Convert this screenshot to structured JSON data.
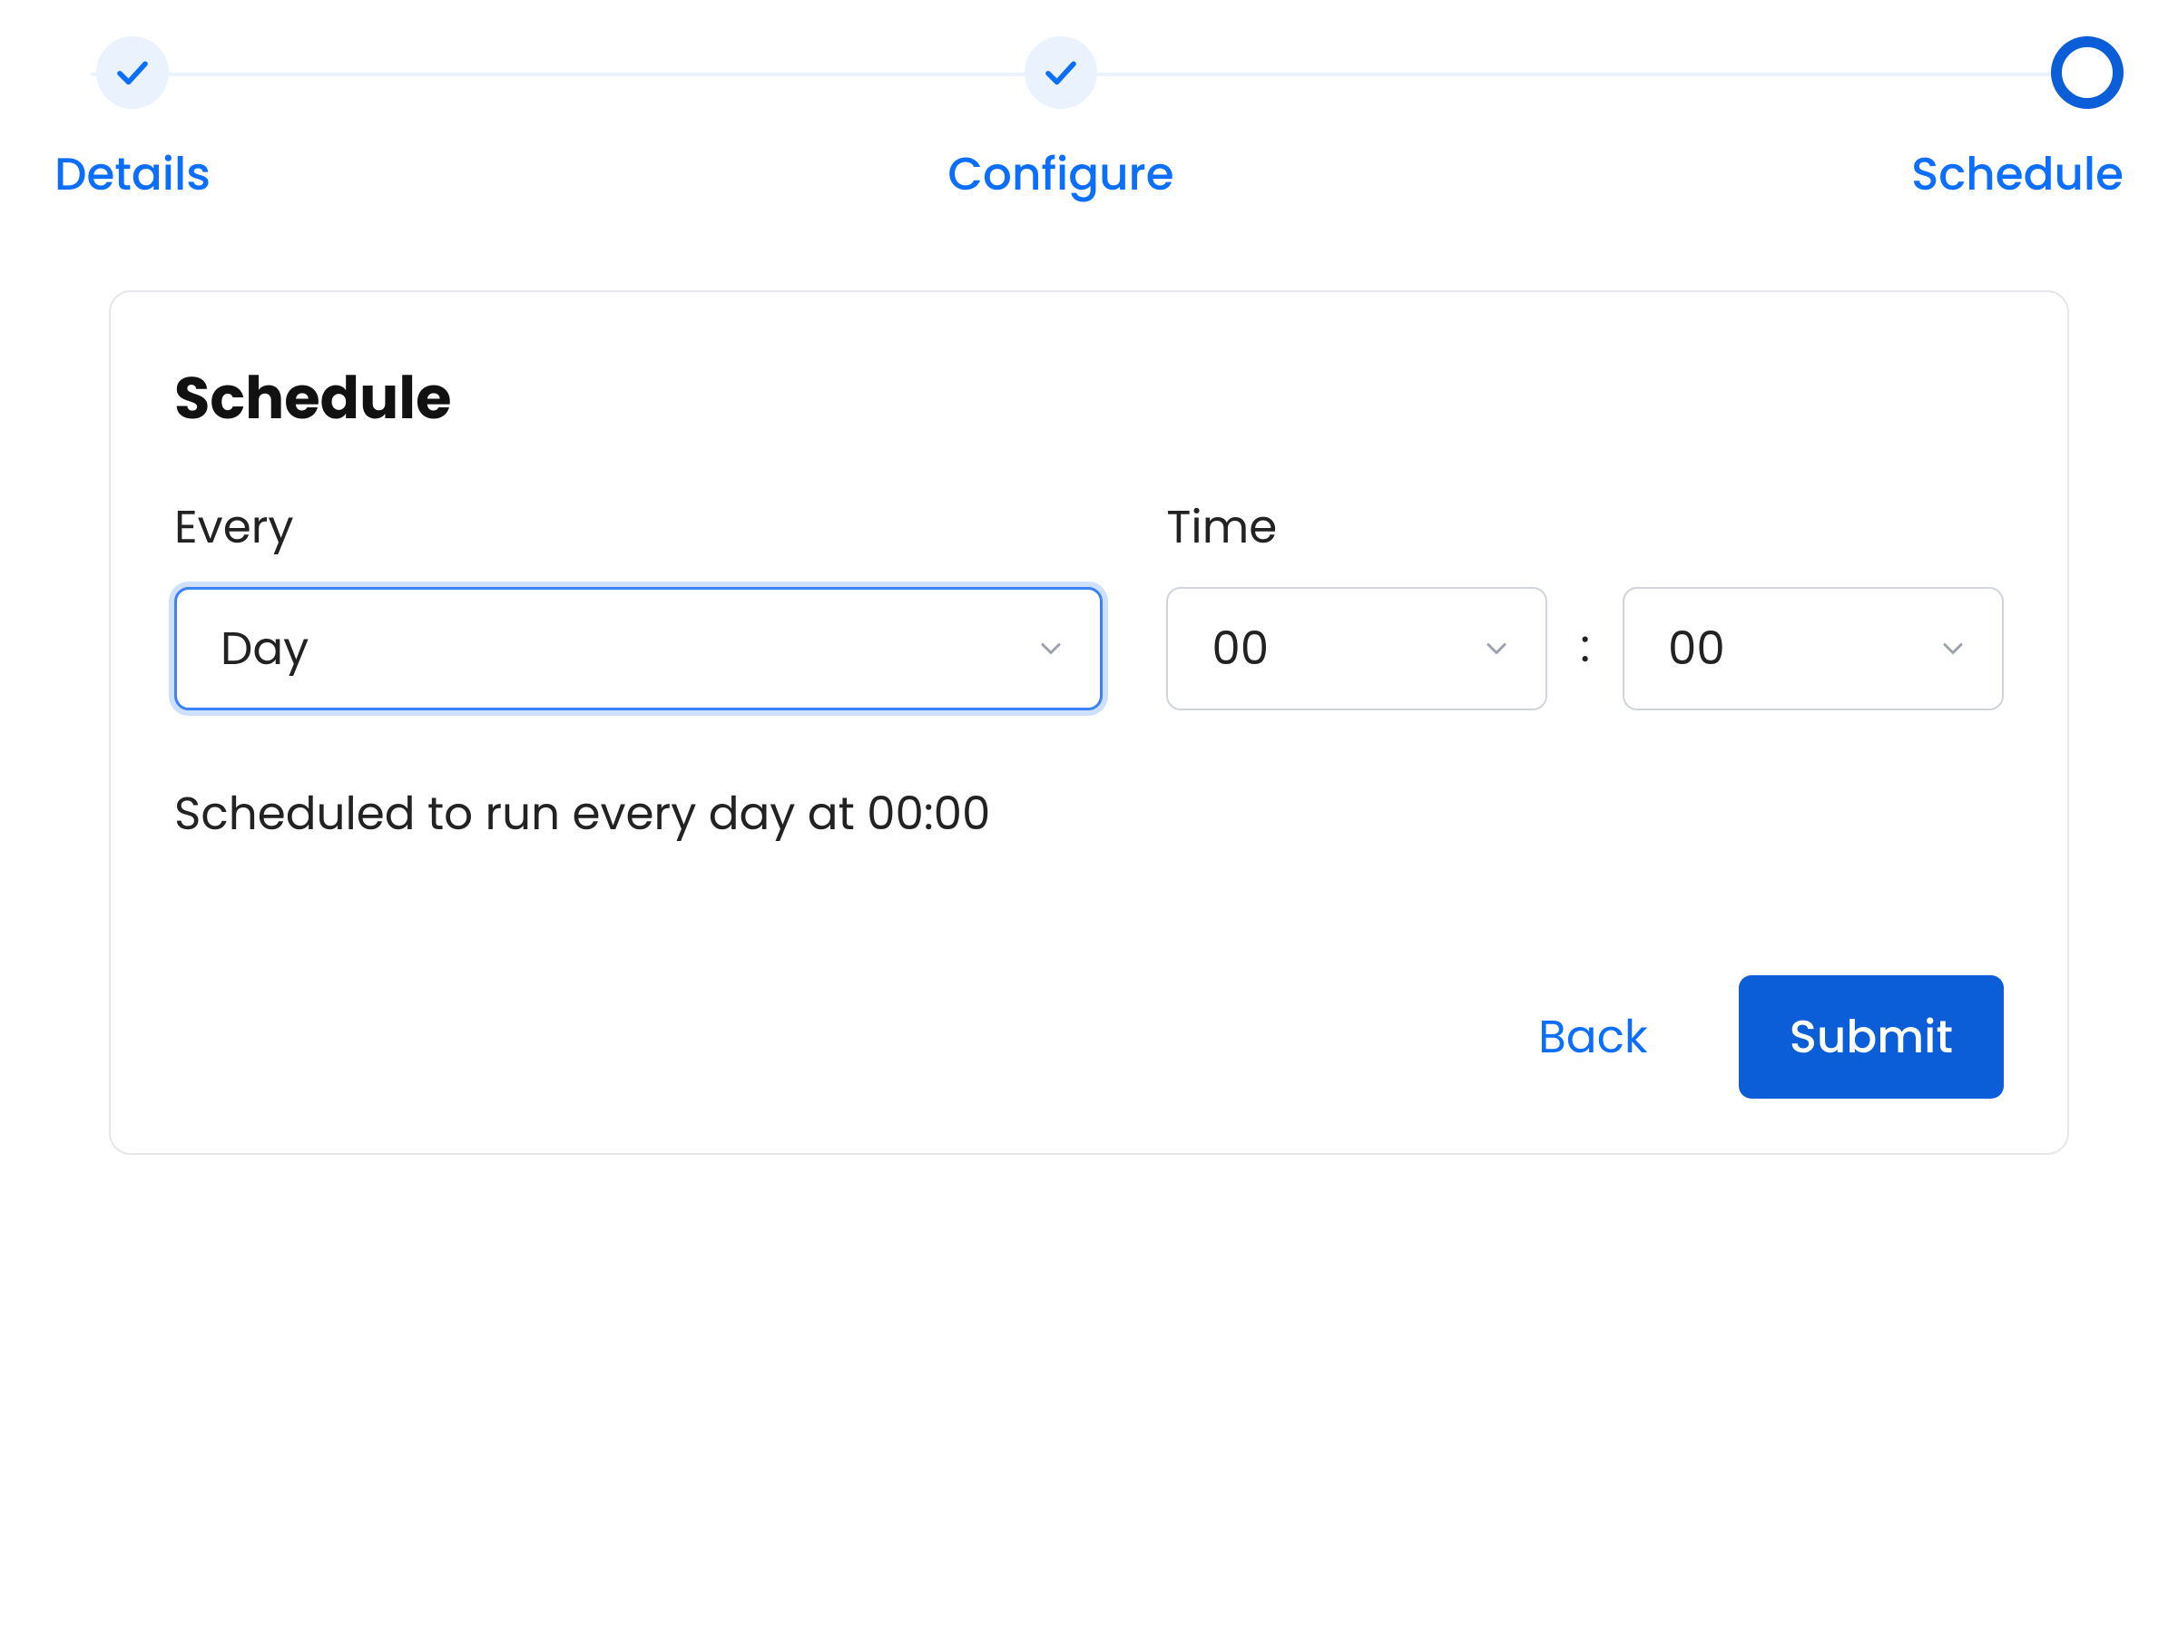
{
  "stepper": {
    "steps": [
      {
        "label": "Details",
        "state": "done"
      },
      {
        "label": "Configure",
        "state": "done"
      },
      {
        "label": "Schedule",
        "state": "current"
      }
    ]
  },
  "card": {
    "title": "Schedule",
    "everyLabel": "Every",
    "everyValue": "Day",
    "timeLabel": "Time",
    "hourValue": "00",
    "minuteValue": "00",
    "timeSeparator": ":",
    "summary": "Scheduled to run every day at 00:00"
  },
  "footer": {
    "backLabel": "Back",
    "submitLabel": "Submit"
  }
}
